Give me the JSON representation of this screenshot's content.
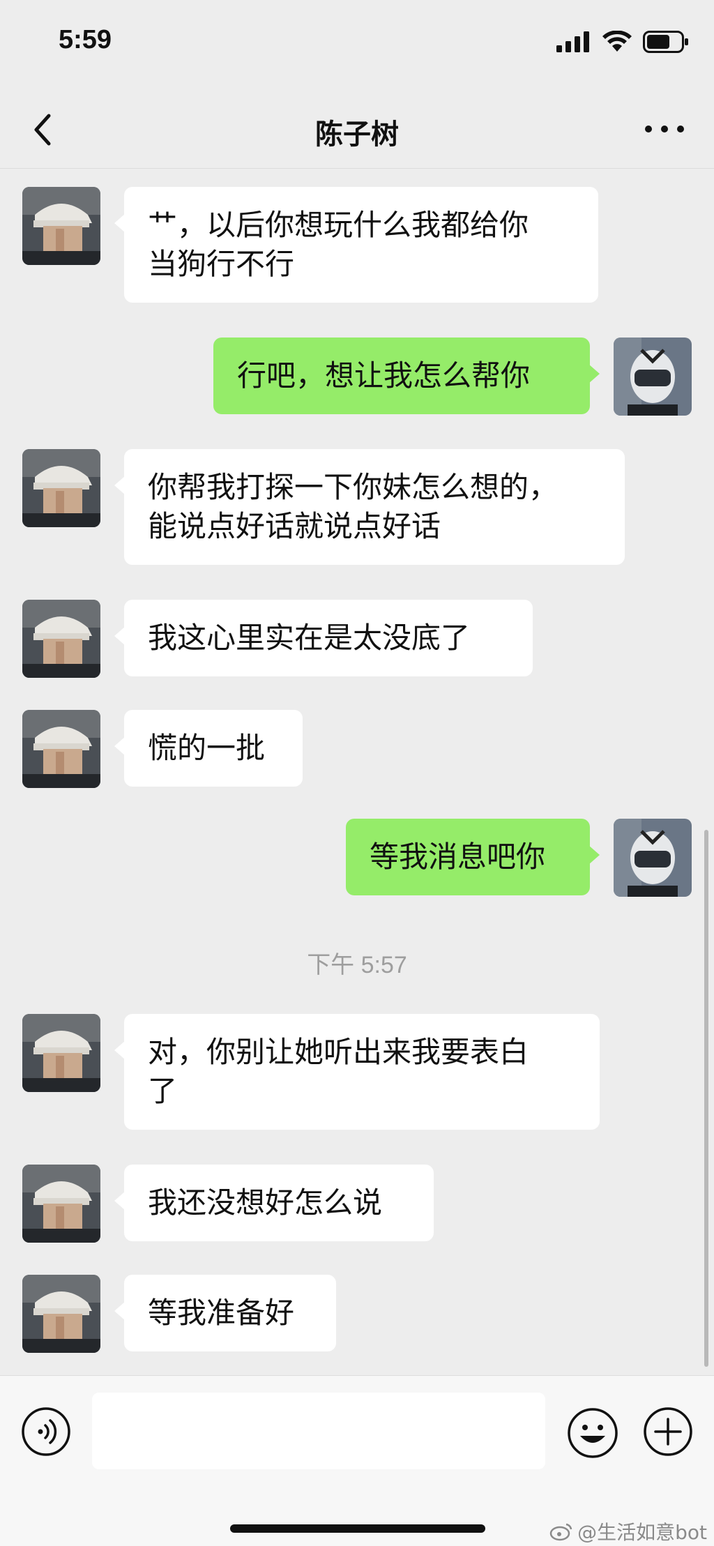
{
  "status_bar": {
    "time": "5:59"
  },
  "nav": {
    "title": "陈子树"
  },
  "messages": [
    {
      "side": "left",
      "text": "艹，以后你想玩什么我都给你\n当狗行不行"
    },
    {
      "side": "right",
      "text": "行吧，想让我怎么帮你"
    },
    {
      "side": "left",
      "text": "你帮我打探一下你妹怎么想的，\n能说点好话就说点好话"
    },
    {
      "side": "left",
      "text": "我这心里实在是太没底了"
    },
    {
      "side": "left",
      "text": "慌的一批"
    },
    {
      "side": "right",
      "text": "等我消息吧你"
    },
    {
      "side": "left",
      "text": "对，你别让她听出来我要表白\n了"
    },
    {
      "side": "left",
      "text": "我还没想好怎么说"
    },
    {
      "side": "left",
      "text": "等我准备好"
    }
  ],
  "timestamp": "下午 5:57",
  "input": {
    "value": ""
  },
  "watermark": "@生活如意bot",
  "colors": {
    "background": "#ededed",
    "sent_bubble": "#95ec69",
    "received_bubble": "#ffffff"
  },
  "icons": [
    "signal-icon",
    "wifi-icon",
    "battery-icon",
    "back-chevron-icon",
    "more-dots-icon",
    "voice-icon",
    "emoji-icon",
    "plus-icon",
    "weibo-icon"
  ]
}
